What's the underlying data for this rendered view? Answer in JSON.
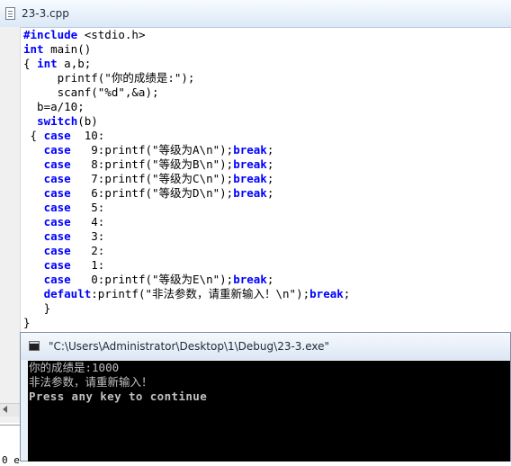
{
  "editor": {
    "tab_title": "23-3.cpp",
    "icons": {
      "document": "document-icon"
    },
    "code_lines": [
      [
        {
          "t": "#include ",
          "k": true
        },
        {
          "t": "<stdio.h>",
          "k": false
        }
      ],
      [
        {
          "t": "int",
          "k": true
        },
        {
          "t": " main()",
          "k": false
        }
      ],
      [
        {
          "t": "{ ",
          "k": false
        },
        {
          "t": "int",
          "k": true
        },
        {
          "t": " a,b;",
          "k": false
        }
      ],
      [
        {
          "t": "     printf(\"你的成绩是:\");",
          "k": false
        }
      ],
      [
        {
          "t": "     scanf(\"%d\",&a);",
          "k": false
        }
      ],
      [
        {
          "t": "  b=a/10;",
          "k": false
        }
      ],
      [
        {
          "t": "  ",
          "k": false
        },
        {
          "t": "switch",
          "k": true
        },
        {
          "t": "(b)",
          "k": false
        }
      ],
      [
        {
          "t": " { ",
          "k": false
        },
        {
          "t": "case",
          "k": true
        },
        {
          "t": "  10:",
          "k": false
        }
      ],
      [
        {
          "t": "   ",
          "k": false
        },
        {
          "t": "case",
          "k": true
        },
        {
          "t": "   9:printf(\"等级为A\\n\");",
          "k": false
        },
        {
          "t": "break",
          "k": true
        },
        {
          "t": ";",
          "k": false
        }
      ],
      [
        {
          "t": "   ",
          "k": false
        },
        {
          "t": "case",
          "k": true
        },
        {
          "t": "   8:printf(\"等级为B\\n\");",
          "k": false
        },
        {
          "t": "break",
          "k": true
        },
        {
          "t": ";",
          "k": false
        }
      ],
      [
        {
          "t": "   ",
          "k": false
        },
        {
          "t": "case",
          "k": true
        },
        {
          "t": "   7:printf(\"等级为C\\n\");",
          "k": false
        },
        {
          "t": "break",
          "k": true
        },
        {
          "t": ";",
          "k": false
        }
      ],
      [
        {
          "t": "   ",
          "k": false
        },
        {
          "t": "case",
          "k": true
        },
        {
          "t": "   6:printf(\"等级为D\\n\");",
          "k": false
        },
        {
          "t": "break",
          "k": true
        },
        {
          "t": ";",
          "k": false
        }
      ],
      [
        {
          "t": "   ",
          "k": false
        },
        {
          "t": "case",
          "k": true
        },
        {
          "t": "   5:",
          "k": false
        }
      ],
      [
        {
          "t": "   ",
          "k": false
        },
        {
          "t": "case",
          "k": true
        },
        {
          "t": "   4:",
          "k": false
        }
      ],
      [
        {
          "t": "   ",
          "k": false
        },
        {
          "t": "case",
          "k": true
        },
        {
          "t": "   3:",
          "k": false
        }
      ],
      [
        {
          "t": "   ",
          "k": false
        },
        {
          "t": "case",
          "k": true
        },
        {
          "t": "   2:",
          "k": false
        }
      ],
      [
        {
          "t": "   ",
          "k": false
        },
        {
          "t": "case",
          "k": true
        },
        {
          "t": "   1:",
          "k": false
        }
      ],
      [
        {
          "t": "   ",
          "k": false
        },
        {
          "t": "case",
          "k": true
        },
        {
          "t": "   0:printf(\"等级为E\\n\");",
          "k": false
        },
        {
          "t": "break",
          "k": true
        },
        {
          "t": ";",
          "k": false
        }
      ],
      [
        {
          "t": "   ",
          "k": false
        },
        {
          "t": "default",
          "k": true
        },
        {
          "t": ":printf(\"非法参数，请重新输入！\\n\");",
          "k": false
        },
        {
          "t": "break",
          "k": true
        },
        {
          "t": ";",
          "k": false
        }
      ],
      [
        {
          "t": "   }",
          "k": false
        }
      ],
      [
        {
          "t": "}",
          "k": false
        }
      ]
    ],
    "colors": {
      "keyword": "#0000ff",
      "text": "#000000"
    }
  },
  "output_pane": {
    "visible_text": "0 e"
  },
  "console": {
    "title": "\"C:\\Users\\Administrator\\Desktop\\1\\Debug\\23-3.exe\"",
    "icons": {
      "window": "console-window-icon"
    },
    "lines": [
      "你的成绩是:1000",
      "非法参数，请重新输入！",
      "Press any key to continue"
    ],
    "colors": {
      "background": "#000000",
      "text": "#c0c0c0"
    }
  }
}
